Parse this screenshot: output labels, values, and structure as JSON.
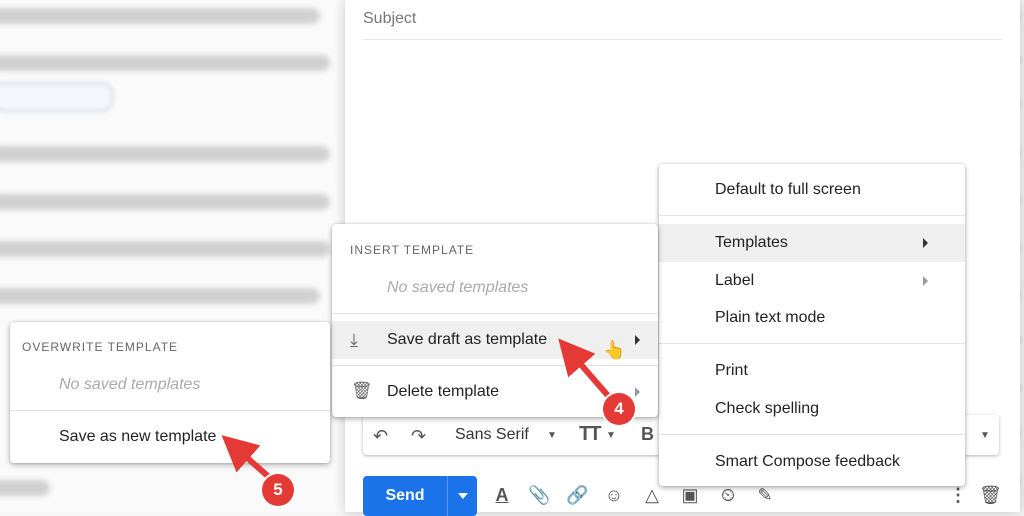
{
  "compose": {
    "subject_placeholder": "Subject",
    "send_label": "Send"
  },
  "format_bar": {
    "font_name": "Sans Serif"
  },
  "more_menu": {
    "items": [
      {
        "label": "Default to full screen"
      },
      {
        "label": "Templates"
      },
      {
        "label": "Label"
      },
      {
        "label": "Plain text mode"
      },
      {
        "label": "Print"
      },
      {
        "label": "Check spelling"
      },
      {
        "label": "Smart Compose feedback"
      }
    ]
  },
  "templates_menu": {
    "header": "INSERT TEMPLATE",
    "empty_text": "No saved templates",
    "save_draft_label": "Save draft as template",
    "delete_label": "Delete template"
  },
  "overwrite_menu": {
    "header": "OVERWRITE TEMPLATE",
    "empty_text": "No saved templates",
    "save_new_label": "Save as new template"
  },
  "callouts": {
    "step_4": "4",
    "step_5": "5"
  },
  "colors": {
    "send_blue": "#1a73e8",
    "callout_red": "#e53935",
    "highlight_gray": "#efefef"
  }
}
